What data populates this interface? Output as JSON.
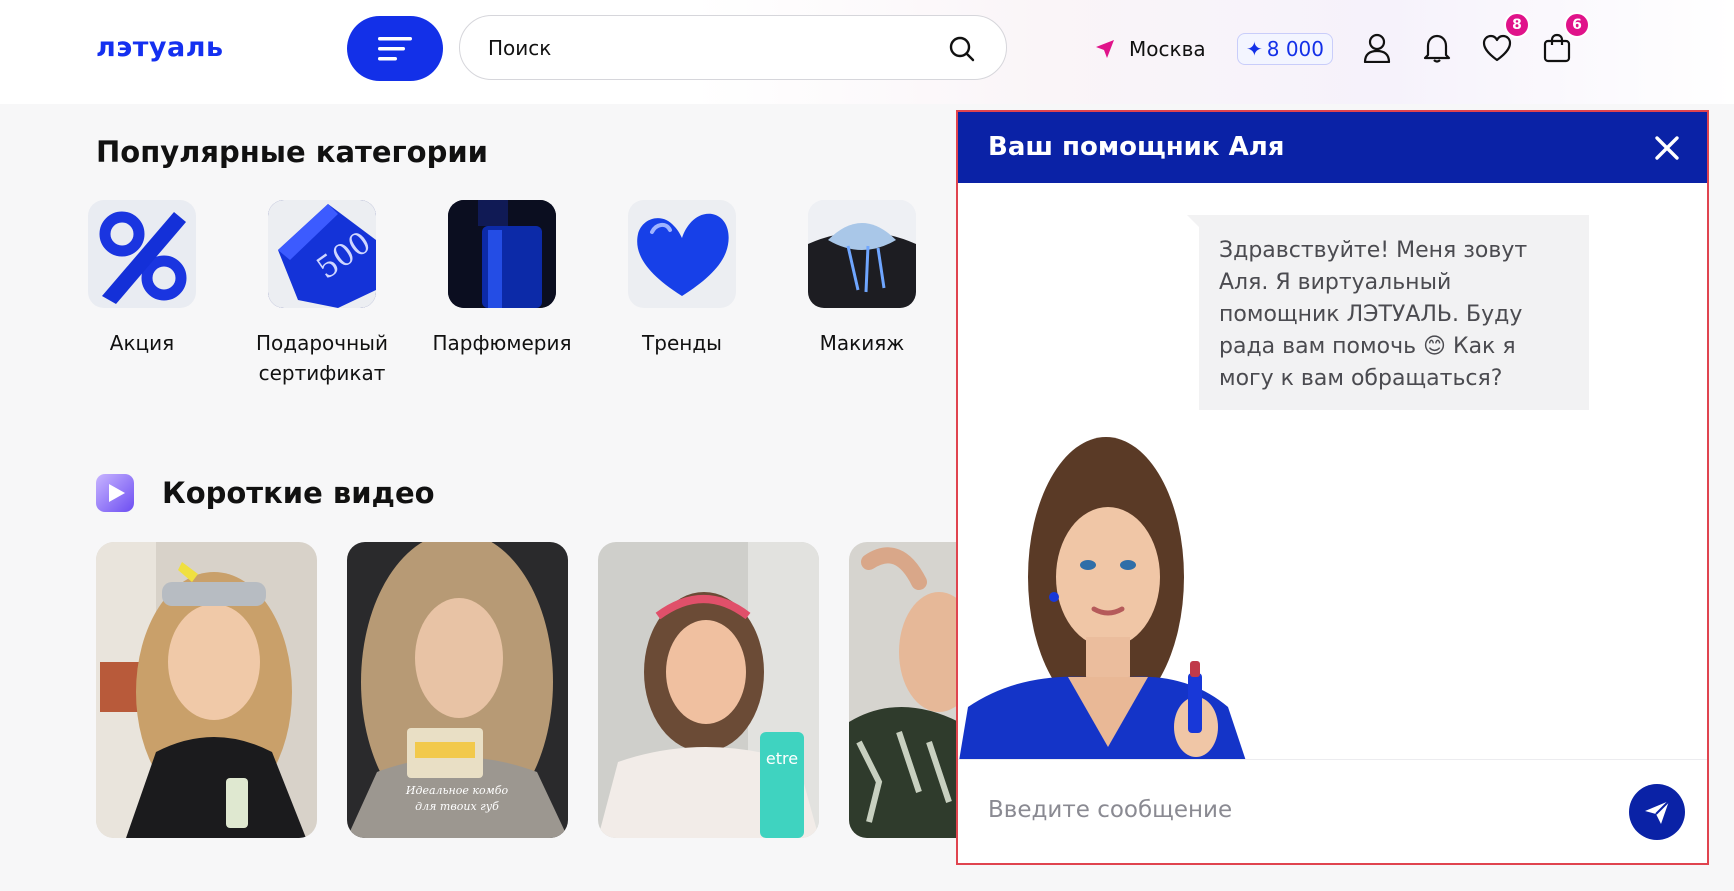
{
  "header": {
    "logo_text": "лэтуаль",
    "search_placeholder": "Поиск",
    "city": "Москва",
    "points": "8 000",
    "favorites_count": "8",
    "cart_count": "6"
  },
  "categories": {
    "title": "Популярные категории",
    "items": [
      {
        "label": "Акция"
      },
      {
        "label": "Подарочный сертификат"
      },
      {
        "label": "Парфюмерия"
      },
      {
        "label": "Тренды"
      },
      {
        "label": "Макияж"
      }
    ]
  },
  "videos": {
    "title": "Короткие видео",
    "thumbnail_caption": "Идеальное комбо для твоих губ",
    "product_brand": "etre"
  },
  "chat": {
    "title": "Ваш помощник Аля",
    "message": "Здравствуйте! Меня зовут Аля. Я виртуальный помощник ЛЭТУАЛЬ. Буду рада вам помочь 😊 Как я могу к вам обращаться?",
    "input_placeholder": "Введите сообщение"
  },
  "colors": {
    "brand_blue": "#1330e8",
    "chat_header": "#0a22a6",
    "badge_pink": "#e0138a",
    "panel_outline": "#e0444f"
  }
}
